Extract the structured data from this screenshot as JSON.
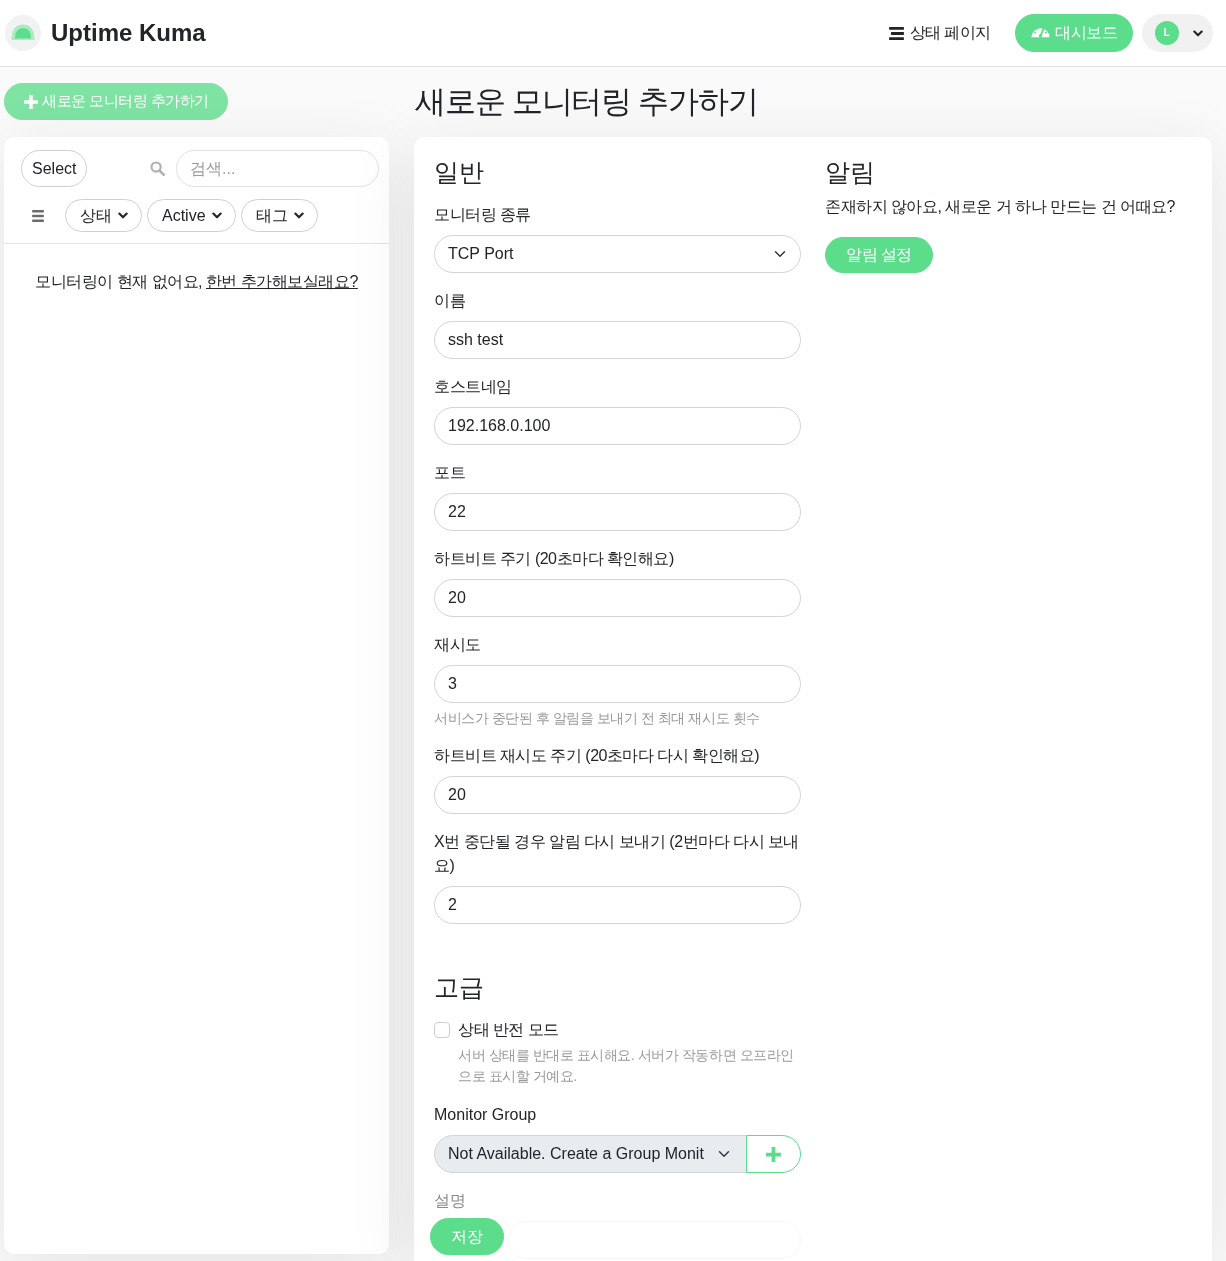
{
  "header": {
    "brand": "Uptime Kuma",
    "status_page_link": "상태 페이지",
    "dashboard_button": "대시보드",
    "avatar_initial": "L"
  },
  "sidebar": {
    "add_button": "새로운 모니터링 추가하기",
    "select_button": "Select",
    "search": {
      "placeholder": "검색..."
    },
    "filters": [
      {
        "label": "상태"
      },
      {
        "label": "Active"
      },
      {
        "label": "태그"
      }
    ],
    "empty_message": {
      "text": "모니터링이 현재 없어요,",
      "link": "한번 추가해보실래요?"
    }
  },
  "page_title": "새로운 모니터링 추가하기",
  "general": {
    "heading": "일반",
    "fields": [
      {
        "kind": "select",
        "label": "모니터링 종류",
        "value": "TCP Port"
      },
      {
        "kind": "text",
        "label": "이름",
        "value": "ssh test"
      },
      {
        "kind": "text",
        "label": "호스트네임",
        "value": "192.168.0.100"
      },
      {
        "kind": "text",
        "label": "포트",
        "value": "22"
      },
      {
        "kind": "text",
        "label": "하트비트 주기 (20초마다 확인해요)",
        "value": "20"
      },
      {
        "kind": "text",
        "label": "재시도",
        "value": "3",
        "help": "서비스가 중단된 후 알림을 보내기 전 최대 재시도 횟수"
      },
      {
        "kind": "text",
        "label": "하트비트 재시도 주기 (20초마다 다시 확인해요)",
        "value": "20"
      },
      {
        "kind": "text",
        "label": "X번 중단될 경우 알림 다시 보내기 (2번마다 다시 보내요)",
        "value": "2"
      }
    ]
  },
  "notifications": {
    "heading": "알림",
    "message": "존재하지 않아요, 새로운 거 하나 만드는 건 어때요?",
    "setup_button": "알림 설정"
  },
  "advanced": {
    "heading": "고급",
    "invert_mode": {
      "label": "상태 반전 모드",
      "checked": false,
      "hint": "서버 상태를 반대로 표시해요. 서버가 작동하면 오프라인으로 표시할 거예요."
    },
    "monitor_group": {
      "label": "Monitor Group",
      "value": "Not Available. Create a Group Monit",
      "disabled": true
    },
    "description": {
      "label": "설명"
    }
  },
  "save_button": "저장"
}
